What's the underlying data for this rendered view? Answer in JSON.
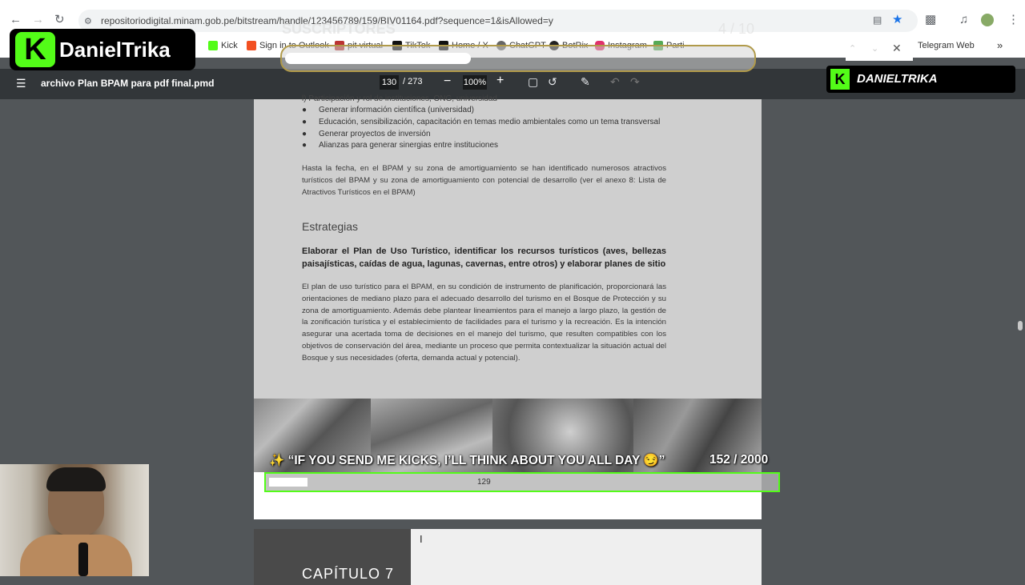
{
  "browser": {
    "url": "repositoriodigital.minam.gob.pe/bitstream/handle/123456789/159/BIV01164.pdf?sequence=1&isAllowed=y",
    "bookmarks": [
      {
        "label": "Kick",
        "icon": "kick-icon"
      },
      {
        "label": "Sign in to Outlook",
        "icon": "microsoft-icon"
      },
      {
        "label": "pit virtual",
        "icon": "bookmark-icon"
      },
      {
        "label": "TikTok",
        "icon": "tiktok-icon"
      },
      {
        "label": "Home / X",
        "icon": "x-icon"
      },
      {
        "label": "ChatGPT",
        "icon": "chatgpt-icon"
      },
      {
        "label": "BotRix",
        "icon": "botrix-icon"
      },
      {
        "label": "Instagram",
        "icon": "instagram-icon"
      },
      {
        "label": "Parti",
        "icon": "bookmark-icon"
      },
      {
        "label": "Telegram Web",
        "icon": "telegram-icon"
      }
    ]
  },
  "pdf": {
    "title": "archivo Plan BPAM para pdf final.pmd",
    "current_page": "130",
    "total_pages": "/ 273",
    "zoom": "100%"
  },
  "document": {
    "top_fragment": "l) Participación y rol de instituciones, ONG, universidad",
    "bullets": [
      "Generar información científica (universidad)",
      "Educación, sensibilización, capacitación en temas medio ambientales como un tema transversal",
      "Generar proyectos de inversión",
      "Alianzas para generar sinergias entre instituciones"
    ],
    "paragraph1": "Hasta la fecha, en el BPAM y su zona de amortiguamiento se han identificado numerosos atractivos turísticos del BPAM y su zona de amortiguamiento con potencial de desarrollo (ver el anexo 8: Lista de Atractivos Turísticos en el BPAM)",
    "heading": "Estrategias",
    "bold_paragraph": "Elaborar el Plan de Uso Turístico, identificar los recursos turísticos (aves, bellezas paisajísticas, caídas de agua, lagunas, cavernas, entre otros) y elaborar planes de sitio",
    "paragraph2": "El plan de uso turístico para el BPAM, en su condición de instrumento de planificación, proporcionará las orientaciones de mediano plazo para el adecuado desarrollo del turismo en el Bosque de Protección y su zona de amortiguamiento. Además debe plantear lineamientos para el manejo a largo plazo, la gestión de la zonificación turística y el establecimiento de facilidades para el turismo y la recreación. Es la intención asegurar una acertada toma de decisiones en el manejo del turismo, que resulten compatibles con los objetivos de conservación del área, mediante un proceso que permita contextualizar la situación actual del Bosque y sus necesidades (oferta, demanda actual y potencial).",
    "page_number": "129",
    "next_page_chapter": "CAPÍTULO 7"
  },
  "overlay": {
    "channel_name": "DanielTrika",
    "channel_name_small": "DANIELTRIKA",
    "subs_label": "SUSCRIPTORES",
    "subs_count": "4 / 10",
    "subs_progress": 0.4,
    "goal_text": "✨ “IF YOU SEND ME KICKS, I’LL THINK ABOUT YOU ALL DAY 😏”",
    "goal_count": "152 / 2000",
    "goal_progress": 0.076
  },
  "colors": {
    "kick_green": "#53fc18",
    "pdf_toolbar": "#323639",
    "viewer_bg": "#525659"
  }
}
